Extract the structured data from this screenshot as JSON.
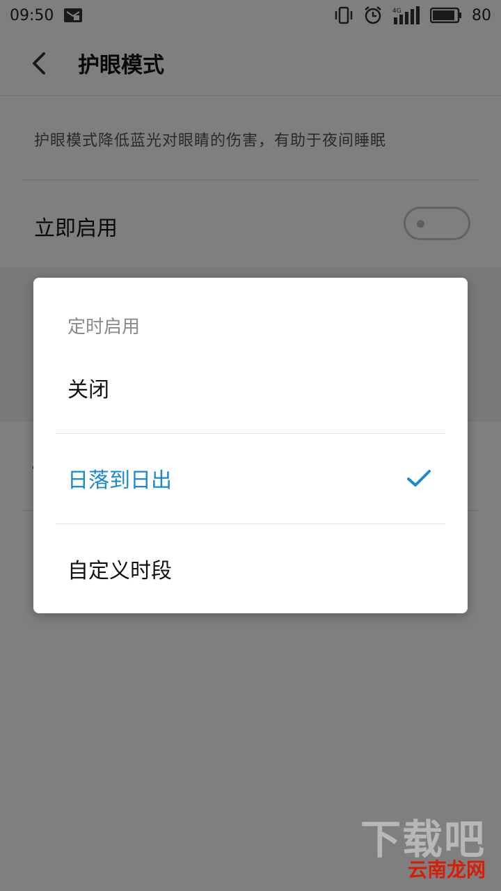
{
  "status_bar": {
    "time": "09:50",
    "battery": "80",
    "network": "4G",
    "icons": [
      "notification-icon",
      "vibrate-icon",
      "alarm-icon",
      "signal-icon",
      "battery-icon"
    ]
  },
  "header": {
    "title": "护眼模式",
    "back_icon": "back-arrow-icon"
  },
  "settings": {
    "description": "护眼模式降低蓝光对眼睛的伤害，有助于夜间睡眠",
    "enable_now_label": "立即启用",
    "enable_now_on": false
  },
  "dialog": {
    "title": "定时启用",
    "options": [
      {
        "label": "关闭",
        "selected": false
      },
      {
        "label": "日落到日出",
        "selected": true
      },
      {
        "label": "自定义时段",
        "selected": false
      }
    ]
  },
  "watermark": {
    "text": "下载吧",
    "sub": "云南龙网"
  },
  "colors": {
    "accent": "#1a8ad0",
    "overlay": "#00000080",
    "watermark_red": "#d81e06"
  }
}
